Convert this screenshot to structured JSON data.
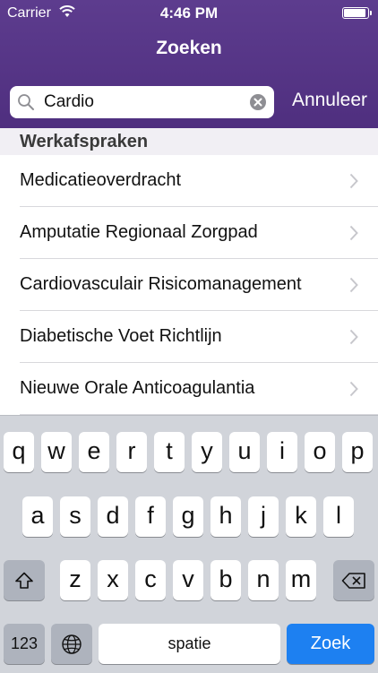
{
  "status_bar": {
    "carrier": "Carrier",
    "time": "4:46 PM"
  },
  "nav": {
    "title": "Zoeken"
  },
  "search": {
    "value": "Cardio",
    "cancel_label": "Annuleer"
  },
  "section": {
    "title": "Werkafspraken"
  },
  "results": [
    {
      "label": "Medicatieoverdracht"
    },
    {
      "label": "Amputatie Regionaal Zorgpad"
    },
    {
      "label": "Cardiovasculair Risicomanagement"
    },
    {
      "label": "Diabetische Voet Richtlijn"
    },
    {
      "label": "Nieuwe Orale Anticoagulantia"
    }
  ],
  "keyboard": {
    "row1": [
      "q",
      "w",
      "e",
      "r",
      "t",
      "y",
      "u",
      "i",
      "o",
      "p"
    ],
    "row2": [
      "a",
      "s",
      "d",
      "f",
      "g",
      "h",
      "j",
      "k",
      "l"
    ],
    "row3": [
      "z",
      "x",
      "c",
      "v",
      "b",
      "n",
      "m"
    ],
    "numbers_label": "123",
    "space_label": "spatie",
    "return_label": "Zoek"
  },
  "colors": {
    "header": "#5d3c8e",
    "return_key": "#1d80f1"
  }
}
